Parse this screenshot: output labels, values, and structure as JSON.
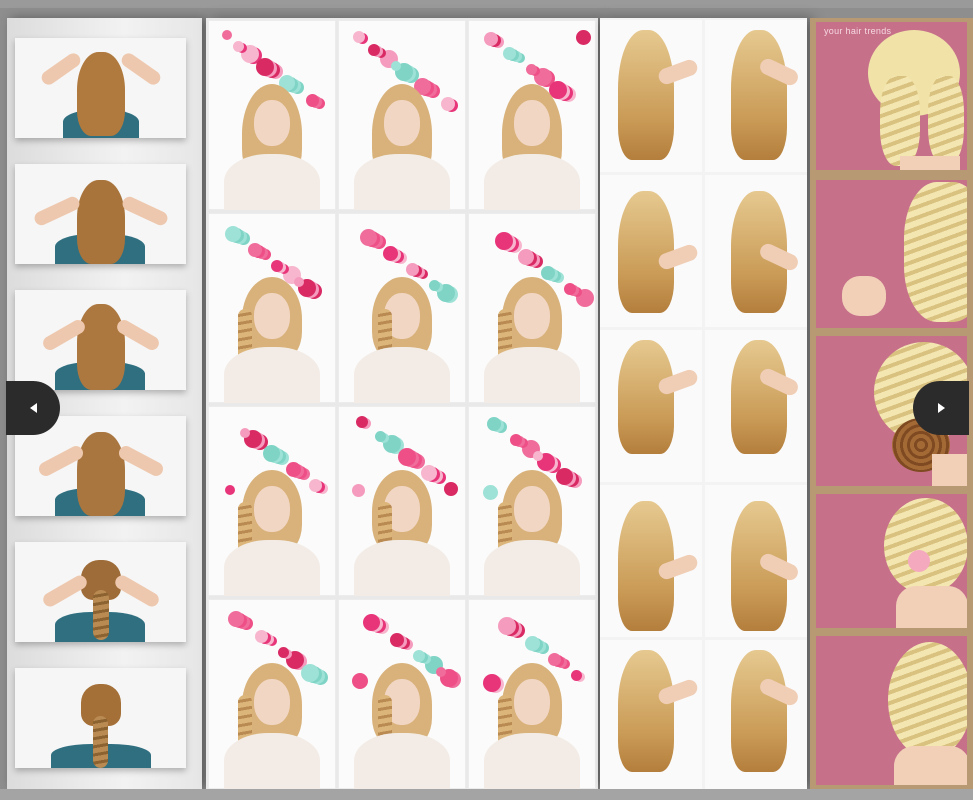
{
  "gallery": {
    "prev_icon": "chevron-left-icon",
    "next_icon": "chevron-right-icon",
    "panels": [
      {
        "name": "braid-steps-back-view",
        "photos": 6
      },
      {
        "name": "balloon-braid-tutorial",
        "photos": 12
      },
      {
        "name": "side-fishtail-tutorial",
        "photos": 10
      },
      {
        "name": "french-braid-updo-steps",
        "photos": 5
      }
    ],
    "watermark": "your hair trends"
  },
  "colors": {
    "background": "#8e8e8e",
    "nav_button": "#2b2b2b",
    "pink_wall": "#c6708a",
    "frame_tan": "#b79a74"
  }
}
